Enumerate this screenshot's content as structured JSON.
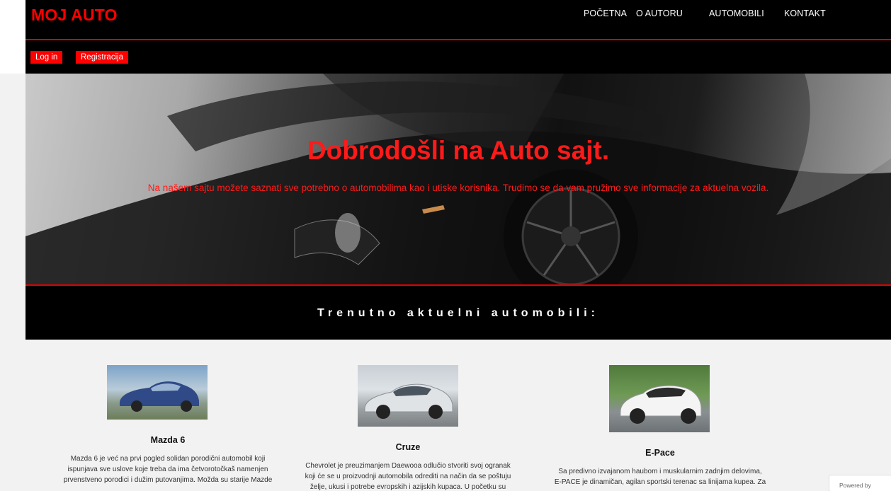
{
  "header": {
    "logo": "MOJ AUTO",
    "nav": [
      "POČETNA",
      "O AUTORU",
      "AUTOMOBILI",
      "KONTAKT"
    ],
    "auth": {
      "login": "Log in",
      "register": "Registracija"
    }
  },
  "hero": {
    "title": "Dobrodošli na Auto sajt.",
    "subtitle": "Na našem sajtu možete saznati sve potrebno o automobilima kao i utiske korisnika. Trudimo se da vam pružimo sve informacije za aktuelna vozila."
  },
  "section": {
    "title": "Trenutno aktuelni automobili:"
  },
  "cars": [
    {
      "name": "Mazda 6",
      "desc": [
        "Mazda 6 je već na prvi pogled solidan porodični automobil koji",
        "ispunjava sve uslove koje treba da ima četvorotočkaš namenjen",
        "prvenstveno porodici i dužim putovanjima. Možda su starije Mazde"
      ],
      "image": "blue-sedan-photo"
    },
    {
      "name": "Cruze",
      "desc": [
        "Chevrolet je preuzimanjem Daewooa odlučio stvoriti svoj ogranak",
        "koji će se u proizvodnji automobila odrediti na način da se poštuju",
        "želje, ukusi i potrebe evropskih i azijskih kupaca. U početku su"
      ],
      "image": "silver-sedan-photo"
    },
    {
      "name": "E-Pace",
      "desc": [
        "Sa predivno izvajanom haubom i muskularnim zadnjim delovima,",
        "E-PACE je dinamičan, agilan sportski terenac sa linijama kupea. Za"
      ],
      "image": "white-suv-photo"
    }
  ],
  "badge": {
    "text": "Powered by"
  },
  "colors": {
    "accent": "#ff0000",
    "bar": "#000000",
    "page": "#f2f2f2"
  }
}
